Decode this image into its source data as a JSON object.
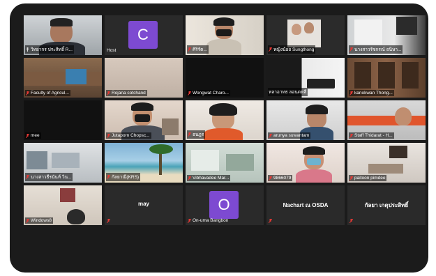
{
  "participants": [
    {
      "name": "วิทยากร ประสิทธิ์ R...",
      "active": true
    },
    {
      "name": "Host",
      "avatar": "C"
    },
    {
      "name": "ศิริรัต..."
    },
    {
      "name": "หญิงน้อย Sungthong"
    },
    {
      "name": "นางสาวรัชกรณ์ ธนิษา..."
    },
    {
      "name": "Faculty of Agricul..."
    },
    {
      "name": "Rojana cotchand"
    },
    {
      "name": "Wongwat Charo..."
    },
    {
      "name": "หลาอาทธ ลอนดหลี"
    },
    {
      "name": "kanokwan Thong..."
    },
    {
      "name": "mee"
    },
    {
      "name": "Jutaporn Chopsc..."
    },
    {
      "name": "ธนฎร"
    },
    {
      "name": "arunya suwantam"
    },
    {
      "name": "Staff Thidarat - H..."
    },
    {
      "name": "นางสาวธีรนันท์ วิน..."
    },
    {
      "name": "กัลยาณี(KRS)"
    },
    {
      "name": "Vibhavadee Mar..."
    },
    {
      "name": "9866079"
    },
    {
      "name": "paitoon pimdee"
    },
    {
      "name": "Windows8"
    },
    {
      "name": "may",
      "center_text": "may"
    },
    {
      "name": "On-uma Bangbon",
      "avatar": "O"
    },
    {
      "name": "",
      "center_text": "Nachart ณ OSDA"
    },
    {
      "name": "",
      "center_text": "กัลยา เกตุประสิทธิ์"
    }
  ],
  "colors": {
    "bezel": "#1b1b1b",
    "tile": "#2a2a2a",
    "avatar": "#7d4ad1",
    "active_border": "#e6e05a",
    "mic_muted": "#e53935"
  }
}
